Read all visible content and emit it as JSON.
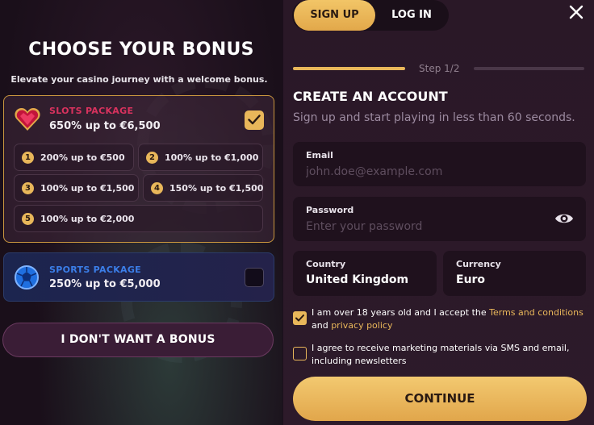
{
  "left": {
    "title": "CHOOSE YOUR BONUS",
    "subtitle": "Elevate your casino journey with a welcome bonus.",
    "slots": {
      "name": "SLOTS PACKAGE",
      "amount": "650% up to €6,500",
      "selected": true,
      "icon": "heart-gem-icon",
      "tiers": [
        {
          "num": "1",
          "text": "200% up to €500"
        },
        {
          "num": "2",
          "text": "100% up to €1,000"
        },
        {
          "num": "3",
          "text": "100% up to €1,500"
        },
        {
          "num": "4",
          "text": "150% up to €1,500"
        },
        {
          "num": "5",
          "text": "100% up to €2,000"
        }
      ]
    },
    "sports": {
      "name": "SPORTS PACKAGE",
      "amount": "250% up to €5,000",
      "selected": false,
      "icon": "soccer-ball-icon"
    },
    "no_bonus_label": "I DON'T WANT A BONUS"
  },
  "right": {
    "tabs": {
      "signup": "SIGN UP",
      "login": "LOG IN",
      "active": "signup"
    },
    "step": "Step 1/2",
    "title": "CREATE AN ACCOUNT",
    "subtitle": "Sign up and start playing in less than 60 seconds.",
    "email": {
      "label": "Email",
      "placeholder": "john.doe@example.com",
      "value": ""
    },
    "password": {
      "label": "Password",
      "placeholder": "Enter your password",
      "value": ""
    },
    "country": {
      "label": "Country",
      "value": "United Kingdom"
    },
    "currency": {
      "label": "Currency",
      "value": "Euro"
    },
    "consent_age": {
      "checked": true,
      "text_before": "I am over 18 years old and I accept the ",
      "terms_link": "Terms and conditions",
      "text_mid": " and ",
      "privacy_link": "privacy policy"
    },
    "consent_marketing": {
      "checked": false,
      "text": "I agree to receive marketing materials via SMS and email, including newsletters"
    },
    "continue_label": "CONTINUE"
  },
  "colors": {
    "accent_gold": "#e9b75a",
    "slots_red": "#d9325e",
    "sports_blue": "#3b7ee8"
  }
}
